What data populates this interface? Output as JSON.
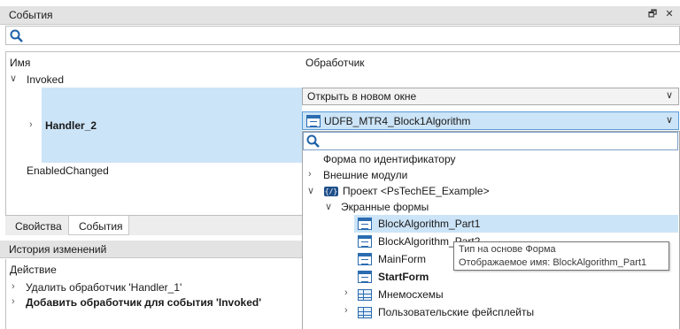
{
  "events_panel": {
    "title": "События",
    "restore_glyph": "🗗",
    "close_glyph": "✕",
    "col_name": "Имя",
    "col_handler": "Обработчик",
    "tree": {
      "invoked": "Invoked",
      "handler": "Handler_2",
      "enabled_changed": "EnabledChanged"
    },
    "open_combo_value": "Открыть в новом окне",
    "handler_combo_value": "UDFB_MTR4_Block1Algorithm"
  },
  "tabs": {
    "properties": "Свойства",
    "events": "События"
  },
  "history_panel": {
    "title": "История изменений",
    "col_action": "Действие",
    "items": [
      "Удалить обработчик 'Handler_1'",
      "Добавить обработчик для события 'Invoked'"
    ]
  },
  "dropdown": {
    "items": {
      "by_id": "Форма по идентификатору",
      "external_modules": "Внешние модули",
      "project": "Проект <PsTechEE_Example>",
      "screen_forms": "Экранные формы",
      "form1": "BlockAlgorithm_Part1",
      "form2": "BlockAlgorithm_Part2",
      "form3": "MainForm",
      "form4": "StartForm",
      "mnemo": "Мнемосхемы",
      "faceplates": "Пользовательские фейсплейты"
    }
  },
  "tooltip": {
    "line1": "Тип на основе Форма",
    "line2": "Отображаемое имя: BlockAlgorithm_Part1"
  },
  "colors": {
    "selection": "#cce4f7",
    "hover": "#dbeaf8",
    "accent": "#2b6cb0"
  }
}
